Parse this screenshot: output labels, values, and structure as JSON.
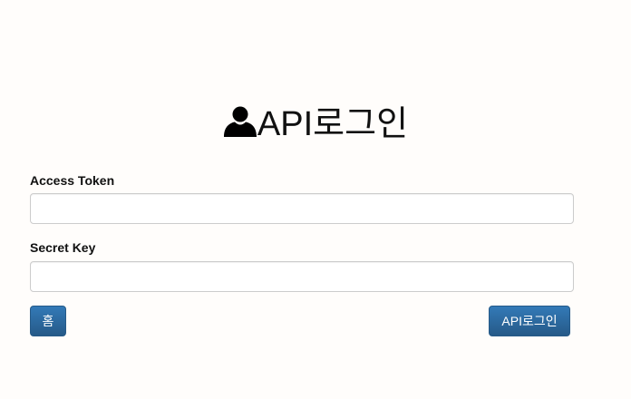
{
  "header": {
    "icon": "user-icon",
    "title": "API로그인"
  },
  "form": {
    "access_token_label": "Access Token",
    "access_token_value": "",
    "secret_key_label": "Secret Key",
    "secret_key_value": ""
  },
  "buttons": {
    "home_label": "홈",
    "login_label": "API로그인"
  },
  "colors": {
    "button_top": "#337ab7",
    "button_bottom": "#265a88",
    "background": "#fffdfb"
  }
}
